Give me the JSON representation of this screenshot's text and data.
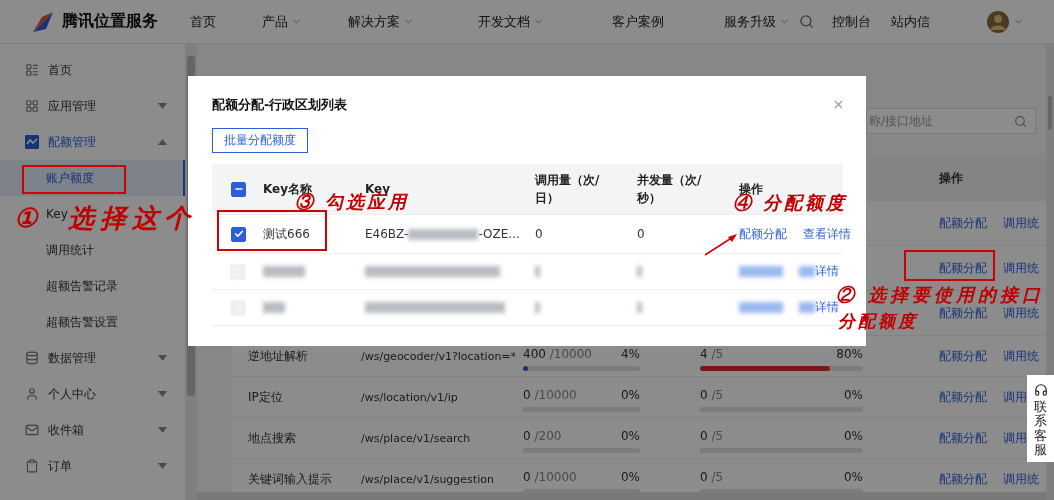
{
  "header": {
    "brand": "腾讯位置服务",
    "nav": [
      {
        "label": "首页",
        "dropdown": false
      },
      {
        "label": "产品",
        "dropdown": true
      },
      {
        "label": "解决方案",
        "dropdown": true
      },
      {
        "label": "开发文档",
        "dropdown": true
      },
      {
        "label": "客户案例",
        "dropdown": false
      },
      {
        "label": "服务升级",
        "dropdown": true
      }
    ],
    "links": [
      "控制台",
      "站内信"
    ]
  },
  "sidebar": {
    "items": [
      {
        "label": "首页",
        "expandable": false
      },
      {
        "label": "应用管理",
        "expandable": true,
        "expanded": false
      },
      {
        "label": "配额管理",
        "expandable": true,
        "expanded": true,
        "children": [
          {
            "label": "账户额度",
            "selected": true
          },
          {
            "label": "Key",
            "selected": false
          },
          {
            "label": "调用统计",
            "selected": false
          },
          {
            "label": "超额告警记录",
            "selected": false
          },
          {
            "label": "超额告警设置",
            "selected": false
          }
        ]
      },
      {
        "label": "数据管理",
        "expandable": true,
        "expanded": false
      },
      {
        "label": "个人中心",
        "expandable": true,
        "expanded": false
      },
      {
        "label": "收件箱",
        "expandable": true,
        "expanded": false
      },
      {
        "label": "订单",
        "expandable": true,
        "expanded": false
      }
    ]
  },
  "search": {
    "placeholder": "称/接口地址"
  },
  "table": {
    "columns": [
      "操作"
    ],
    "rows": [
      {
        "actions": [
          "配额分配",
          "调用统"
        ]
      },
      {
        "actions": [
          "配额分配",
          "调用统"
        ]
      },
      {
        "actions": [
          "配额分配",
          "调用统"
        ]
      },
      {
        "name": "逆地址解析",
        "path": "/ws/geocoder/v1?location=*",
        "usage": {
          "used": "400",
          "total": "/10000",
          "percent": "4%",
          "level": 0.04
        },
        "concurrency": {
          "used": "4",
          "total": "/5",
          "percent": "80%",
          "level": 0.8
        },
        "actions": [
          "配额分配",
          "调用统"
        ]
      },
      {
        "name": "IP定位",
        "path": "/ws/location/v1/ip",
        "usage": {
          "used": "0",
          "total": "/10000",
          "percent": "0%",
          "level": 0
        },
        "concurrency": {
          "used": "0",
          "total": "/5",
          "percent": "0%",
          "level": 0
        },
        "actions": [
          "配额分配",
          "调用"
        ]
      },
      {
        "name": "地点搜索",
        "path": "/ws/place/v1/search",
        "usage": {
          "used": "0",
          "total": "/200",
          "percent": "0%",
          "level": 0
        },
        "concurrency": {
          "used": "0",
          "total": "/5",
          "percent": "0%",
          "level": 0
        },
        "actions": [
          "配额分配",
          "调用"
        ]
      },
      {
        "name": "关键词输入提示",
        "path": "/ws/place/v1/suggestion",
        "usage": {
          "used": "0",
          "total": "/10000",
          "percent": "0%",
          "level": 0
        },
        "concurrency": {
          "used": "0",
          "total": "/5",
          "percent": "0%",
          "level": 0
        },
        "actions": [
          "配额分配",
          "调用统"
        ]
      }
    ]
  },
  "dialog": {
    "title": "配额分配-行政区划列表",
    "batch_button": "批量分配额度",
    "header_checkbox": {
      "checked": true,
      "indeterminate": true
    },
    "columns": [
      "Key名称",
      "Key",
      "调用量（次/日）",
      "并发量（次/秒）",
      "操作"
    ],
    "rows": [
      {
        "kind": "plain",
        "checked": true,
        "name": "测试666",
        "key_start": "E46BZ-",
        "key_end": "-OZE...",
        "calls": "0",
        "concurrency": "0",
        "actions": [
          "配额分配",
          "查看详情"
        ]
      },
      {
        "kind": "blurred",
        "checked": false,
        "action_tail": "详情"
      },
      {
        "kind": "blurred",
        "checked": false,
        "action_tail": "详情"
      }
    ]
  },
  "service": {
    "label": "联系客服"
  },
  "annotations": [
    {
      "kind": "box"
    },
    {
      "kind": "note",
      "text": "①"
    },
    {
      "kind": "note",
      "text": "选择这个"
    },
    {
      "kind": "note",
      "text": "③ 勾选应用"
    },
    {
      "kind": "box"
    },
    {
      "kind": "note",
      "text": "④ 分配额度"
    },
    {
      "kind": "arrow"
    },
    {
      "kind": "box"
    },
    {
      "kind": "note",
      "text": "② 选择要使用的接口"
    },
    {
      "kind": "note",
      "text": "分配额度"
    }
  ]
}
